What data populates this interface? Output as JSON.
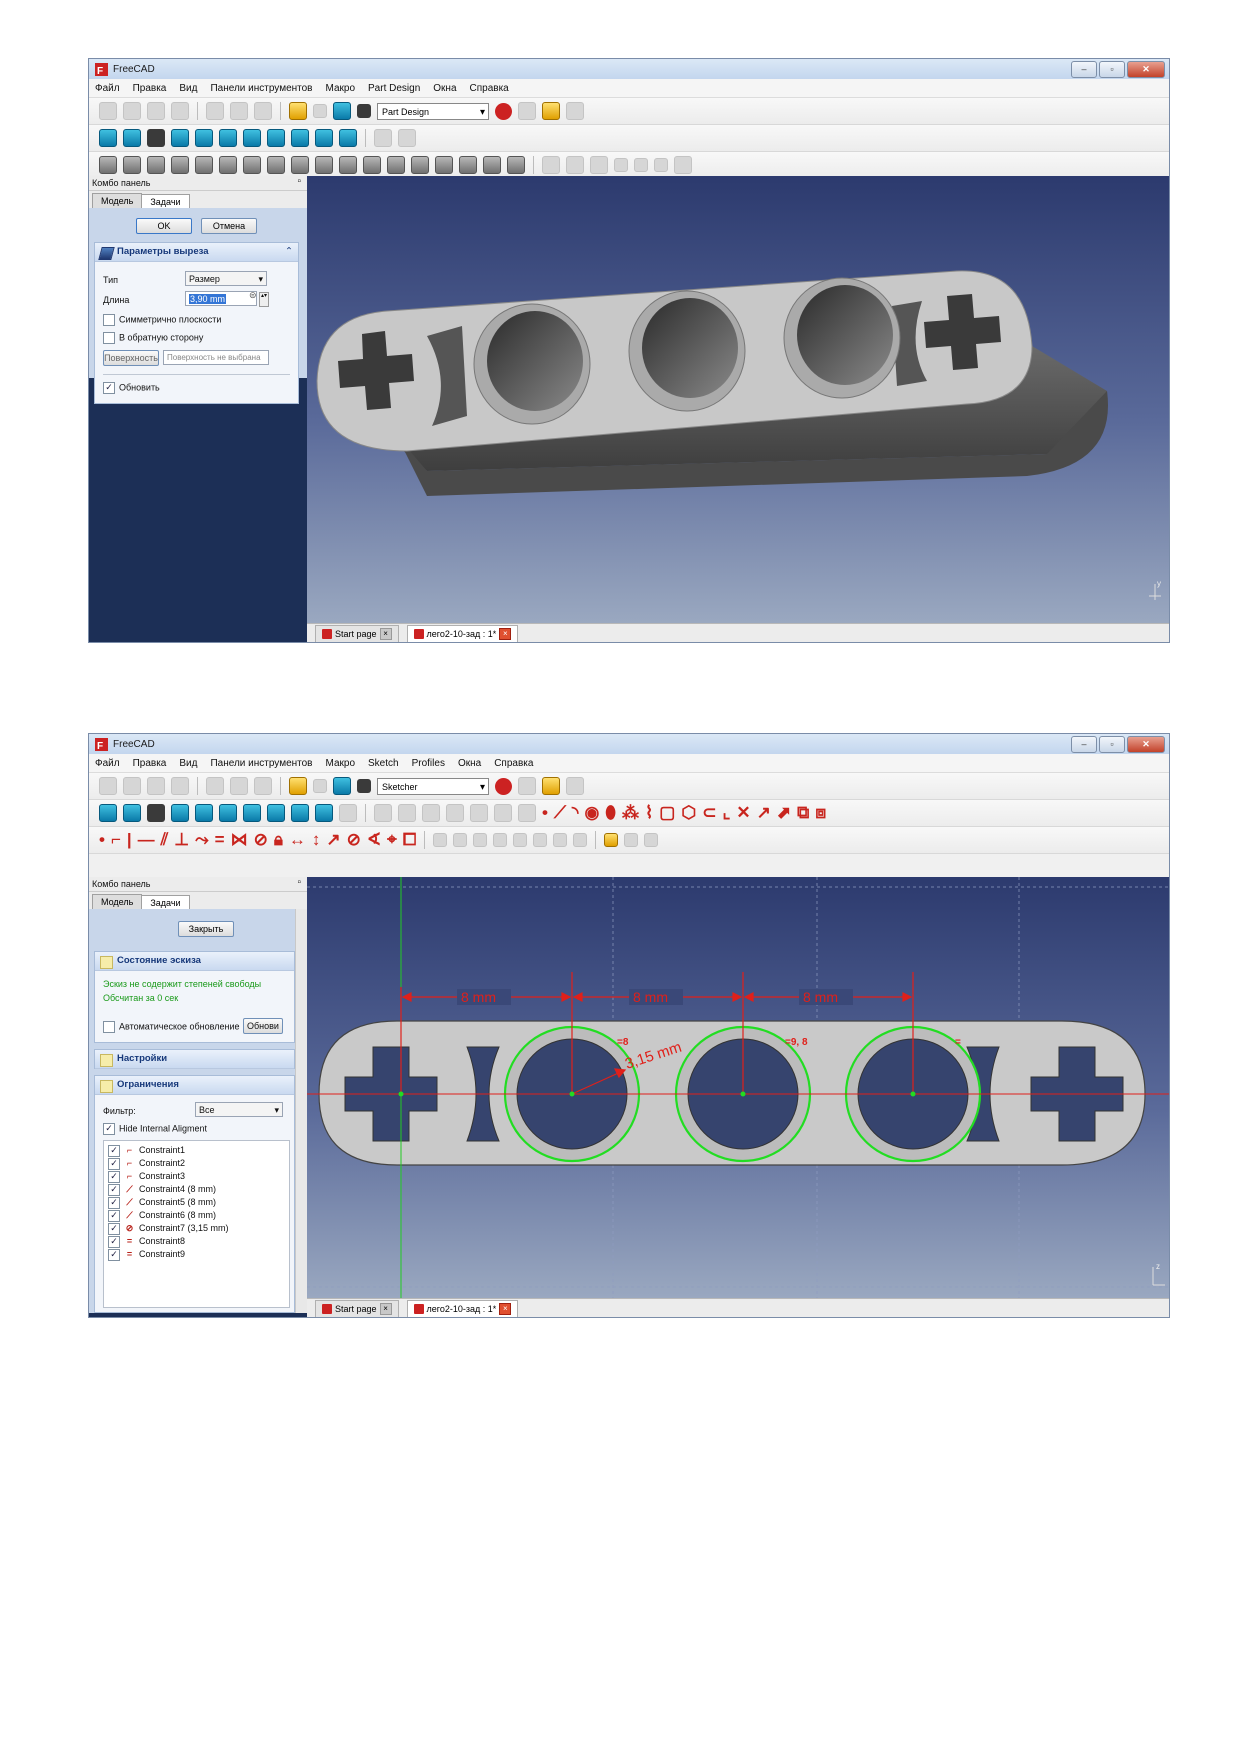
{
  "app_title": "FreeCAD",
  "window1": {
    "menus": [
      "Файл",
      "Правка",
      "Вид",
      "Панели инструментов",
      "Макро",
      "Part Design",
      "Окна",
      "Справка"
    ],
    "workbench": "Part Design",
    "combo_title": "Комбо панель",
    "tab_model": "Модель",
    "tab_tasks": "Задачи",
    "ok_label": "OK",
    "cancel_label": "Отмена",
    "panel_title": "Параметры выреза",
    "type_label": "Тип",
    "type_value": "Размер",
    "length_label": "Длина",
    "length_value": "3,90 mm",
    "symmetric_label": "Симметрично плоскости",
    "reverse_label": "В обратную сторону",
    "face_button": "Поверхность",
    "face_value": "Поверхность не выбрана",
    "update_label": "Обновить",
    "tabs": [
      {
        "label": "Start page"
      },
      {
        "label": "лего2-10-зад : 1*"
      }
    ]
  },
  "window2": {
    "menus": [
      "Файл",
      "Правка",
      "Вид",
      "Панели инструментов",
      "Макро",
      "Sketch",
      "Profiles",
      "Окна",
      "Справка"
    ],
    "workbench": "Sketcher",
    "combo_title": "Комбо панель",
    "tab_model": "Модель",
    "tab_tasks": "Задачи",
    "close_label": "Закрыть",
    "state_title": "Состояние эскиза",
    "state_line1": "Эскиз не содержит степеней свободы",
    "state_line2": "Обсчитан за 0 сек",
    "auto_update_label": "Автоматическое обновление",
    "update_btn": "Обнови",
    "settings_title": "Настройки",
    "constraints_title": "Ограничения",
    "filter_label": "Фильтр:",
    "filter_value": "Все",
    "hide_internal_label": "Hide Internal Aligment",
    "constraints": [
      {
        "label": "Constraint1",
        "icon": "coincident-icon",
        "glyph": "⌐"
      },
      {
        "label": "Constraint2",
        "icon": "coincident-icon",
        "glyph": "⌐"
      },
      {
        "label": "Constraint3",
        "icon": "coincident-icon",
        "glyph": "⌐"
      },
      {
        "label": "Constraint4 (8 mm)",
        "icon": "distance-icon",
        "glyph": "⟋"
      },
      {
        "label": "Constraint5 (8 mm)",
        "icon": "distance-icon",
        "glyph": "⟋"
      },
      {
        "label": "Constraint6 (8 mm)",
        "icon": "distance-icon",
        "glyph": "⟋"
      },
      {
        "label": "Constraint7 (3,15 mm)",
        "icon": "radius-icon",
        "glyph": "⊘"
      },
      {
        "label": "Constraint8",
        "icon": "equal-icon",
        "glyph": "="
      },
      {
        "label": "Constraint9",
        "icon": "equal-icon",
        "glyph": "="
      }
    ],
    "dim_labels": {
      "d1": "8 mm",
      "d2": "8 mm",
      "d3": "8 mm",
      "radius": "3,15 mm",
      "eq1": "=8",
      "eq2": "=9, 8",
      "eq3": "="
    },
    "tabs": [
      {
        "label": "Start page"
      },
      {
        "label": "лего2-10-зад : 1*"
      }
    ]
  },
  "colors": {
    "constraint_red": "#e0201a",
    "circle_green": "#22dd22",
    "viewport_top": "#2c3a6e",
    "part_gray": "#c8c8c8"
  }
}
